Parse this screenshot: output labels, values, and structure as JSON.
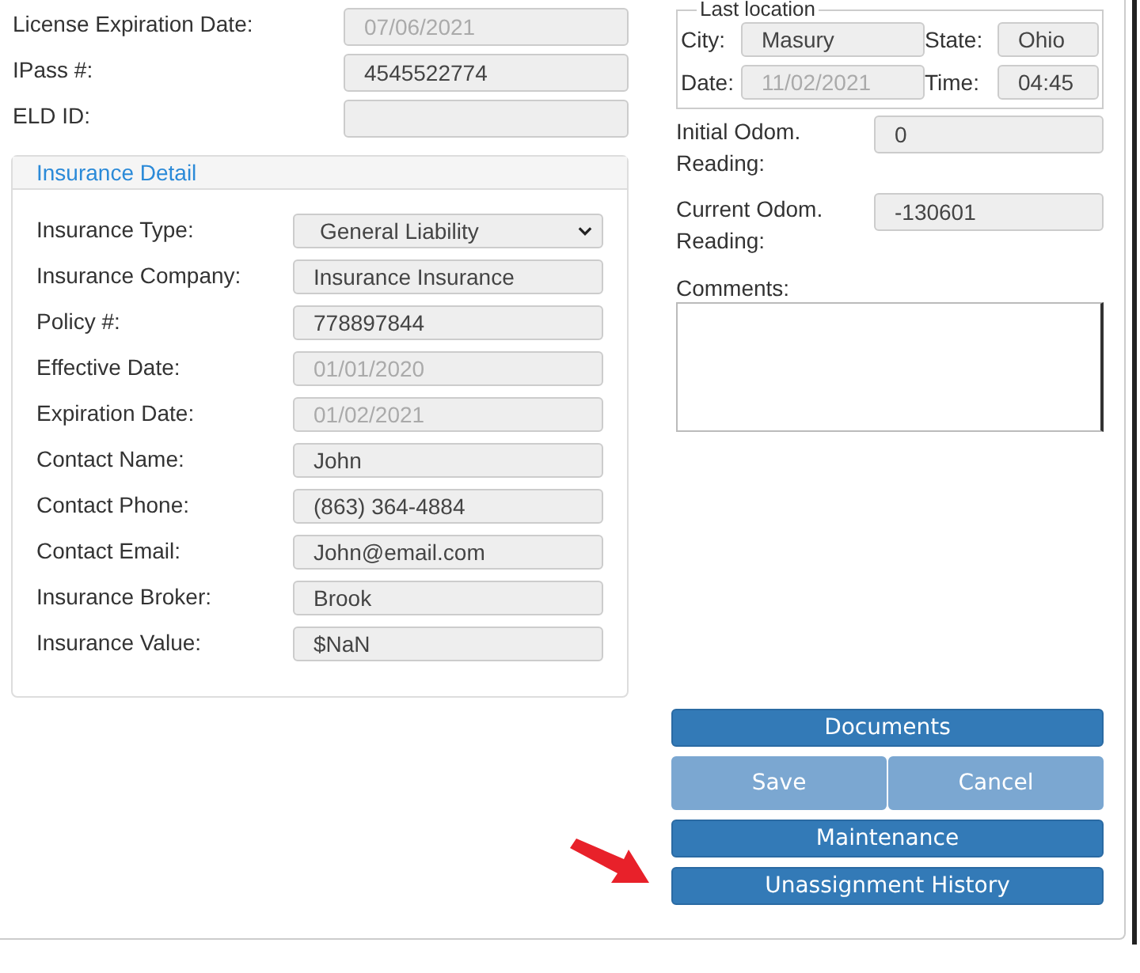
{
  "top_fields": [
    {
      "label": "License Expiration Date:",
      "value": "07/06/2021",
      "disabled": true
    },
    {
      "label": "IPass #:",
      "value": "4545522774",
      "disabled": false
    },
    {
      "label": "ELD ID:"
    }
  ],
  "insurance": {
    "title": "Insurance Detail",
    "fields": [
      {
        "label": "Insurance Type:",
        "value": "General Liability",
        "kind": "select",
        "disabled": false
      },
      {
        "label": "Insurance Company:",
        "value": "Insurance Insurance",
        "kind": "text",
        "disabled": false
      },
      {
        "label": "Policy #:",
        "value": "778897844",
        "kind": "text",
        "disabled": false
      },
      {
        "label": "Effective Date:",
        "value": "01/01/2020",
        "kind": "text",
        "disabled": true
      },
      {
        "label": "Expiration Date:",
        "value": "01/02/2021",
        "kind": "text",
        "disabled": true
      },
      {
        "label": "Contact Name:",
        "value": "John",
        "kind": "text",
        "disabled": false
      },
      {
        "label": "Contact Phone:",
        "value": "(863) 364-4884",
        "kind": "text",
        "disabled": false
      },
      {
        "label": "Contact Email:",
        "value": "John@email.com",
        "kind": "text",
        "disabled": false
      },
      {
        "label": "Insurance Broker:",
        "value": "Brook",
        "kind": "text",
        "disabled": false
      },
      {
        "label": "Insurance Value:",
        "value": "$NaN",
        "kind": "text",
        "disabled": false
      }
    ]
  },
  "last_location": {
    "legend": "Last location",
    "rows": [
      [
        {
          "label": "City:",
          "value": "Masury",
          "disabled": false
        },
        {
          "label": "State:",
          "value": "Ohio",
          "disabled": false
        }
      ],
      [
        {
          "label": "Date:",
          "value": "11/02/2021",
          "disabled": true
        },
        {
          "label": "Time:",
          "value": "04:45",
          "disabled": false
        }
      ]
    ]
  },
  "odometer": [
    {
      "label": "Initial Odom. Reading:",
      "value": "0"
    },
    {
      "label": "Current Odom. Reading:",
      "value": "-130601"
    }
  ],
  "comments": {
    "label": "Comments:"
  },
  "button_rows": [
    {
      "buttons": [
        {
          "label": "Documents",
          "disabled": false
        }
      ]
    },
    {
      "buttons": [
        {
          "label": "Save",
          "disabled": true
        },
        {
          "label": "Cancel",
          "disabled": true
        }
      ]
    },
    {
      "buttons": [
        {
          "label": "Maintenance",
          "disabled": false
        }
      ]
    },
    {
      "buttons": [
        {
          "label": "Unassignment History",
          "disabled": false
        }
      ]
    }
  ]
}
